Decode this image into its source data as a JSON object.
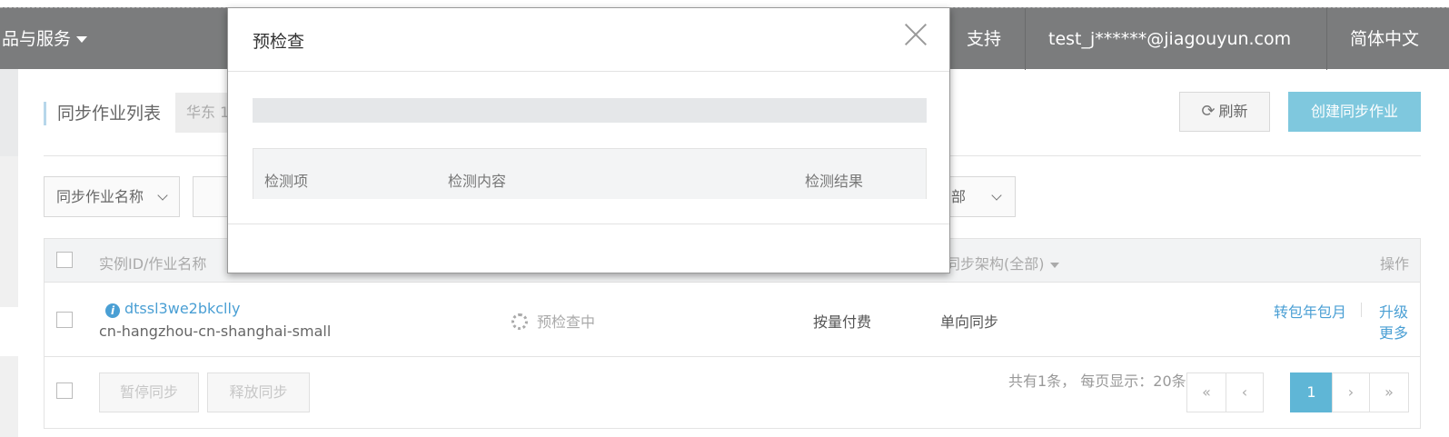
{
  "topnav": {
    "products_label": "品与服务",
    "support_label": "支持",
    "user_email": "test_j******@jiagouyun.com",
    "language_label": "简体中文"
  },
  "page": {
    "title": "同步作业列表",
    "region": "华东 1",
    "refresh_label": "刷新",
    "create_label": "创建同步作业"
  },
  "filters": {
    "name_select": "同步作业名称",
    "right_select": "部"
  },
  "table": {
    "headers": {
      "instance": "实例ID/作业名称",
      "architecture": "同步架构(全部)",
      "actions": "操作"
    },
    "rows": [
      {
        "instance_id": "dtssl3we2bkclly",
        "job_name": "cn-hangzhou-cn-shanghai-small",
        "status": "预检查中",
        "billing": "按量付费",
        "architecture": "单向同步",
        "actions": [
          "转包年包月",
          "升级",
          "更多"
        ]
      }
    ],
    "footer": {
      "pause_label": "暂停同步",
      "release_label": "释放同步",
      "summary": "共有1条， 每页显示：20条",
      "pager": [
        "«",
        "‹",
        "1",
        "›",
        "»"
      ]
    }
  },
  "modal": {
    "title": "预检查",
    "columns": {
      "item": "检测项",
      "content": "检测内容",
      "result": "检测结果"
    },
    "progress": 0
  }
}
